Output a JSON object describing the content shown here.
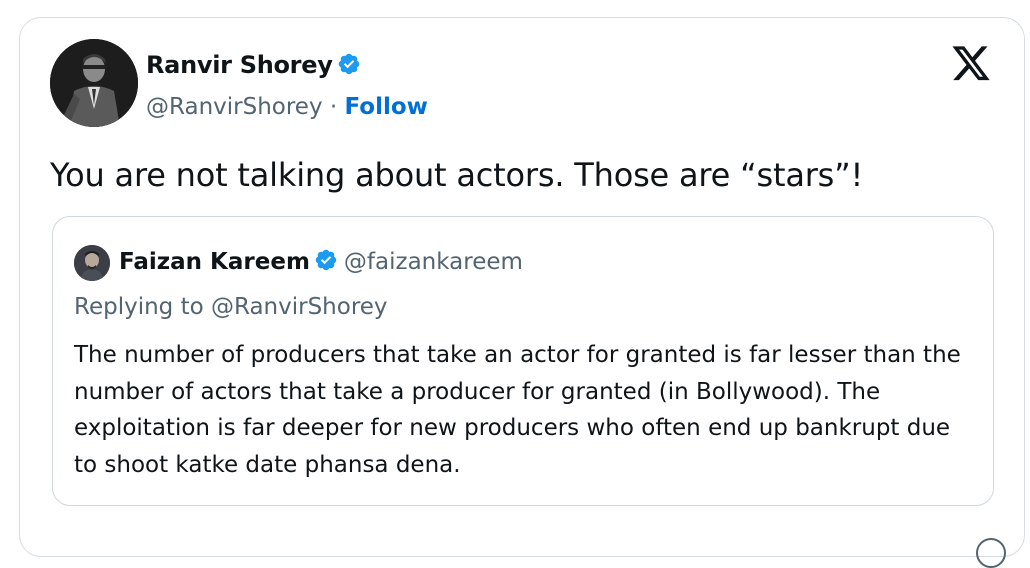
{
  "tweet": {
    "author": {
      "name": "Ranvir Shorey",
      "handle": "@RanvirShorey",
      "separator": "·",
      "follow_label": "Follow",
      "avatar_icon": "profile-photo",
      "verified_icon": "verified-badge-icon"
    },
    "text": "You are not talking about actors. Those are “stars”!",
    "platform_icon": "x-logo-icon",
    "quote": {
      "author_name": "Faizan Kareem",
      "author_handle": "@faizankareem",
      "replying_to": "Replying to @RanvirShorey",
      "text": "The number of producers that take an actor for granted is far lesser than the number of actors that take a producer for granted (in Bollywood). The exploitation is far deeper for new producers who often end up bankrupt due to shoot katke date phansa dena."
    }
  },
  "colors": {
    "verified": "#1d9bf0",
    "follow": "#006fd6",
    "secondary_text": "#536471",
    "primary_text": "#0f1419",
    "border": "#cfd9de"
  }
}
